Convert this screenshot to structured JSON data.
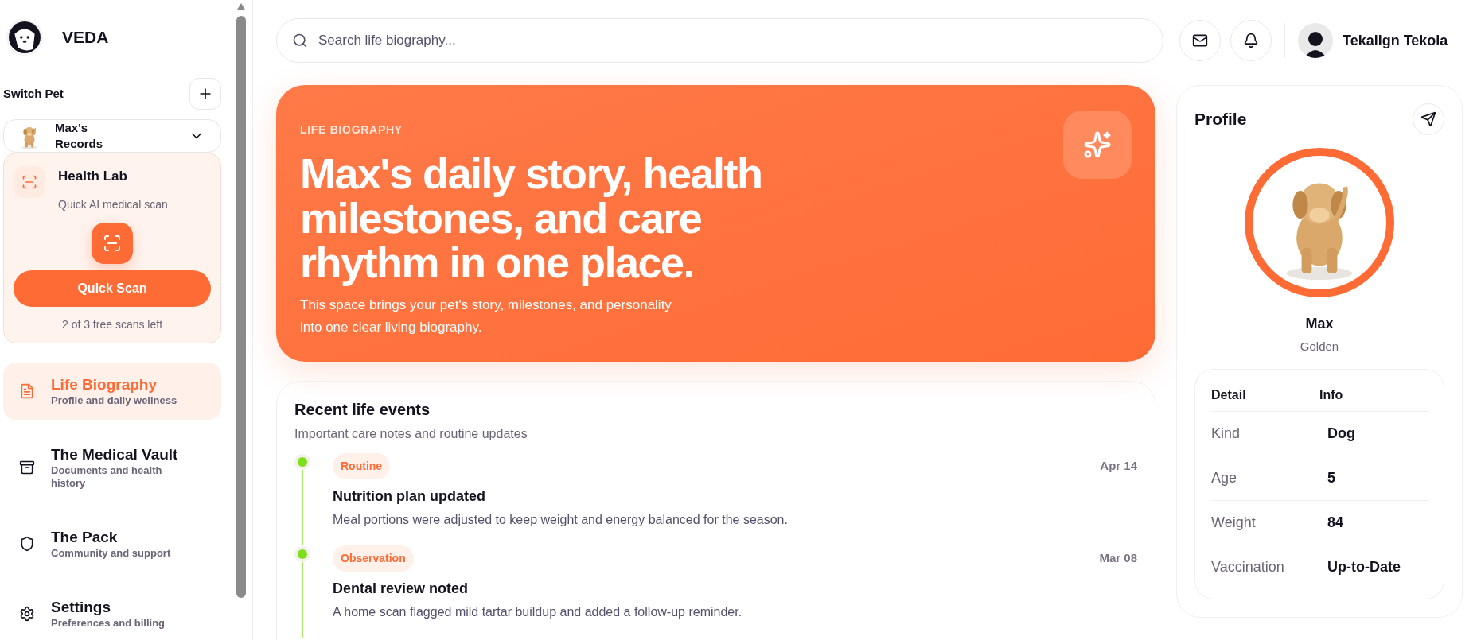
{
  "brand": {
    "name": "VEDA"
  },
  "switch_pet": {
    "label": "Switch Pet",
    "pet_name": "Max's Records"
  },
  "health_lab": {
    "title": "Health Lab",
    "subtitle": "Quick AI medical scan",
    "button": "Quick Scan",
    "note": "2 of 3 free scans left"
  },
  "nav": [
    {
      "kind": "document",
      "title": "Life Biography",
      "subtitle": "Profile and daily wellness",
      "selected": true
    },
    {
      "kind": "archive",
      "title": "The Medical Vault",
      "subtitle": "Documents and health history",
      "selected": false
    },
    {
      "kind": "shield",
      "title": "The Pack",
      "subtitle": "Community and support",
      "selected": false
    },
    {
      "kind": "gear",
      "title": "Settings",
      "subtitle": "Preferences and billing",
      "selected": false
    }
  ],
  "search": {
    "placeholder": "Search life biography..."
  },
  "user": {
    "name": "Tekalign Tekola"
  },
  "hero": {
    "eyebrow": "LIFE BIOGRAPHY",
    "headline": "Max's daily story, health milestones, and care rhythm in one place.",
    "body": "This space brings your pet's story, milestones, and personality into one clear living biography."
  },
  "events": {
    "title": "Recent life events",
    "subtitle": "Important care notes and routine updates",
    "items": [
      {
        "tag": "Routine",
        "date": "Apr 14",
        "title": "Nutrition plan updated",
        "text": "Meal portions were adjusted to keep weight and energy balanced for the season.",
        "color": "#7ee01a"
      },
      {
        "tag": "Observation",
        "date": "Mar 08",
        "title": "Dental review noted",
        "text": "A home scan flagged mild tartar buildup and added a follow-up reminder.",
        "color": "#7ee01a"
      }
    ]
  },
  "profile": {
    "title": "Profile",
    "name": "Max",
    "breed": "Golden",
    "table": {
      "columns": [
        "Detail",
        "Info"
      ],
      "rows": [
        [
          "Kind",
          "Dog"
        ],
        [
          "Age",
          "5"
        ],
        [
          "Weight",
          "84"
        ],
        [
          "Vaccination",
          "Up-to-Date"
        ]
      ]
    }
  }
}
